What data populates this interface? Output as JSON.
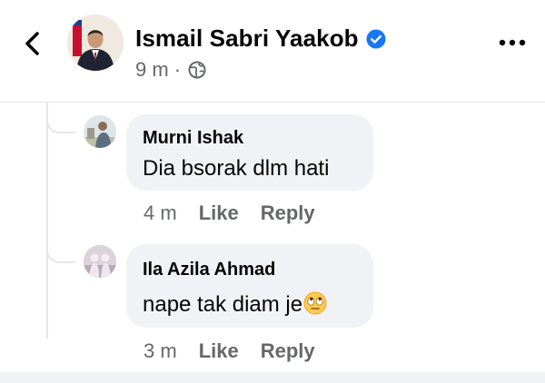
{
  "header": {
    "page_name": "Ismail Sabri Yaakob",
    "post_time": "9 m",
    "separator": "·",
    "back_icon": "chevron-left-icon",
    "verified_icon": "verified-badge-icon",
    "audience_icon": "globe-icon",
    "more_icon": "more-horizontal-icon"
  },
  "comments": [
    {
      "author": "Murni Ishak",
      "text": "Dia bsorak dlm hati",
      "time": "4 m",
      "like_label": "Like",
      "reply_label": "Reply"
    },
    {
      "author": "Ila Azila Ahmad",
      "text": "nape tak diam je",
      "emoji": "face-with-rolling-eyes",
      "time": "3 m",
      "like_label": "Like",
      "reply_label": "Reply"
    }
  ],
  "colors": {
    "verified": "#1877f2",
    "bubble": "#f0f2f5",
    "secondary_text": "#65676b",
    "divider": "#e4e6eb"
  }
}
